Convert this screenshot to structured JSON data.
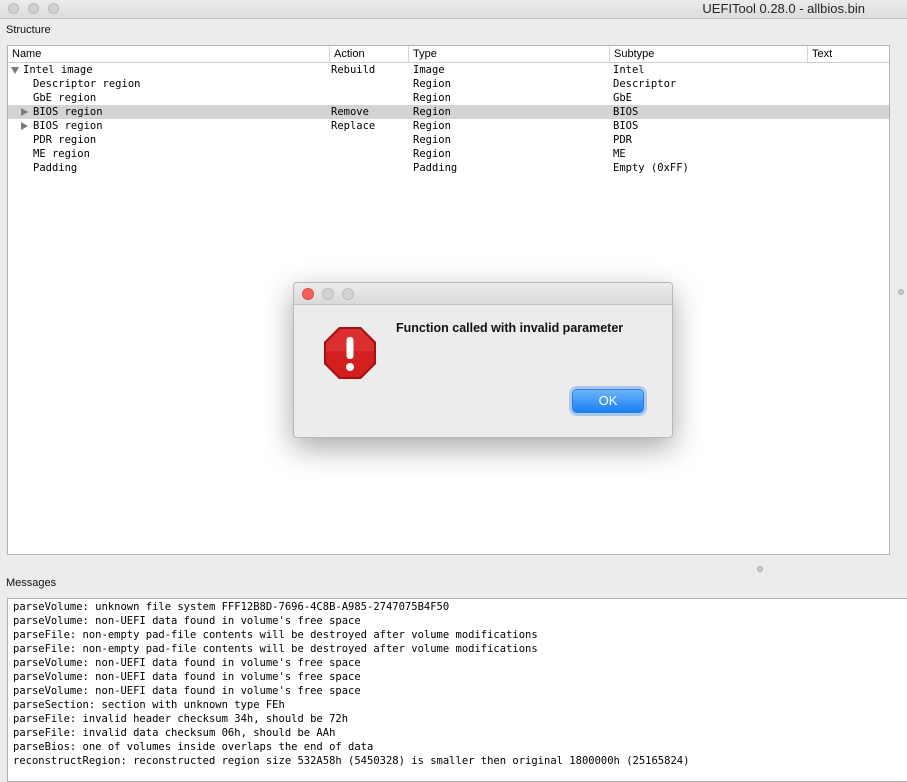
{
  "window": {
    "title": "UEFITool 0.28.0 - allbios.bin"
  },
  "structure": {
    "label": "Structure",
    "columns": [
      "Name",
      "Action",
      "Type",
      "Subtype",
      "Text"
    ],
    "rows": [
      {
        "name": "Intel image",
        "action": "Rebuild",
        "type": "Image",
        "subtype": "Intel",
        "expander": "open",
        "level": 0,
        "selected": false
      },
      {
        "name": "Descriptor region",
        "action": "",
        "type": "Region",
        "subtype": "Descriptor",
        "expander": "none",
        "level": 1,
        "selected": false
      },
      {
        "name": "GbE region",
        "action": "",
        "type": "Region",
        "subtype": "GbE",
        "expander": "none",
        "level": 1,
        "selected": false
      },
      {
        "name": "BIOS region",
        "action": "Remove",
        "type": "Region",
        "subtype": "BIOS",
        "expander": "closed",
        "level": 1,
        "selected": true
      },
      {
        "name": "BIOS region",
        "action": "Replace",
        "type": "Region",
        "subtype": "BIOS",
        "expander": "closed",
        "level": 1,
        "selected": false
      },
      {
        "name": "PDR region",
        "action": "",
        "type": "Region",
        "subtype": "PDR",
        "expander": "none",
        "level": 1,
        "selected": false
      },
      {
        "name": "ME region",
        "action": "",
        "type": "Region",
        "subtype": "ME",
        "expander": "none",
        "level": 1,
        "selected": false
      },
      {
        "name": "Padding",
        "action": "",
        "type": "Padding",
        "subtype": "Empty (0xFF)",
        "expander": "none",
        "level": 1,
        "selected": false
      }
    ]
  },
  "messages": {
    "label": "Messages",
    "lines": [
      "parseVolume: unknown file system FFF12B8D-7696-4C8B-A985-2747075B4F50",
      "parseVolume: non-UEFI data found in volume's free space",
      "parseFile: non-empty pad-file contents will be destroyed after volume modifications",
      "parseFile: non-empty pad-file contents will be destroyed after volume modifications",
      "parseVolume: non-UEFI data found in volume's free space",
      "parseVolume: non-UEFI data found in volume's free space",
      "parseVolume: non-UEFI data found in volume's free space",
      "parseSection: section with unknown type FEh",
      "parseFile: invalid header checksum 34h, should be 72h",
      "parseFile: invalid data checksum 06h, should be AAh",
      "parseBios: one of volumes inside overlaps the end of data",
      "reconstructRegion: reconstructed region size 532A58h (5450328) is smaller then original 1800000h (25165824)"
    ]
  },
  "dialog": {
    "message": "Function called with invalid parameter",
    "ok_label": "OK",
    "icon": "stop-warning-icon",
    "colors": {
      "close": "#fc5f57",
      "accent": "#1b7ff3",
      "stop": "#d21f1f"
    }
  }
}
